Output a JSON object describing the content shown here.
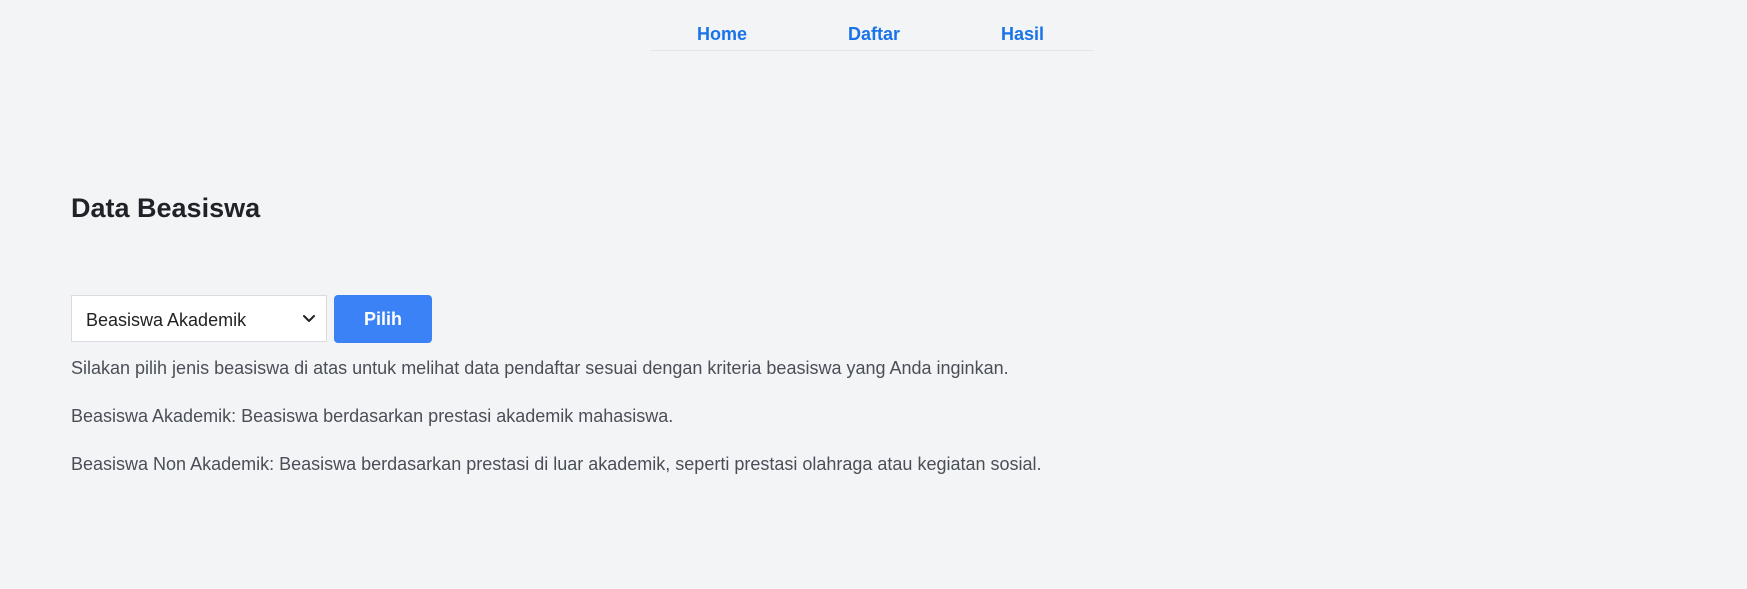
{
  "nav": {
    "home": "Home",
    "daftar": "Daftar",
    "hasil": "Hasil"
  },
  "page": {
    "title": "Data Beasiswa"
  },
  "form": {
    "select_value": "Beasiswa Akademik",
    "button_label": "Pilih"
  },
  "info": {
    "line1": "Silakan pilih jenis beasiswa di atas untuk melihat data pendaftar sesuai dengan kriteria beasiswa yang Anda inginkan.",
    "line2": "Beasiswa Akademik: Beasiswa berdasarkan prestasi akademik mahasiswa.",
    "line3": "Beasiswa Non Akademik: Beasiswa berdasarkan prestasi di luar akademik, seperti prestasi olahraga atau kegiatan sosial."
  },
  "icons": {
    "select_arrow": "chevron-down-icon"
  },
  "colors": {
    "background": "#f3f4f6",
    "link": "#1a73e8",
    "button": "#3b82f6"
  }
}
